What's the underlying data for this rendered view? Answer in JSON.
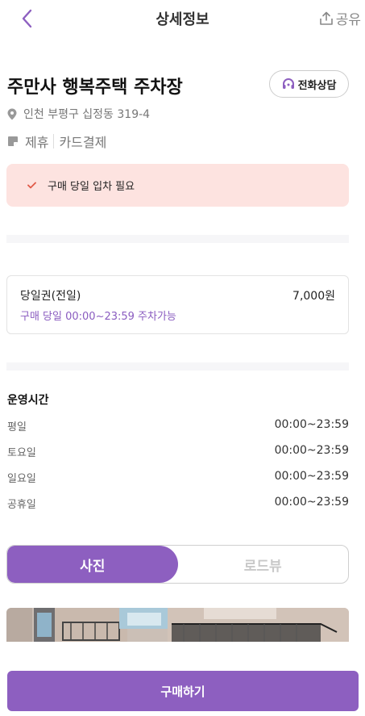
{
  "header": {
    "title": "상세정보",
    "share_label": "공유"
  },
  "lot": {
    "name": "주만사 행복주택 주차장",
    "call_label": "전화상담",
    "address": "인천 부평구 십정동 319-4",
    "tags": [
      "제휴",
      "카드결제"
    ]
  },
  "notice": {
    "text": "구매 당일 입차 필요"
  },
  "ticket": {
    "name": "당일권(전일)",
    "price": "7,000원",
    "time": "구매 당일 00:00~23:59 주차가능"
  },
  "hours": {
    "title": "운영시간",
    "rows": [
      {
        "day": "평일",
        "time": "00:00~23:59"
      },
      {
        "day": "토요일",
        "time": "00:00~23:59"
      },
      {
        "day": "일요일",
        "time": "00:00~23:59"
      },
      {
        "day": "공휴일",
        "time": "00:00~23:59"
      }
    ]
  },
  "media_tabs": {
    "photo_label": "사진",
    "roadview_label": "로드뷰"
  },
  "footer": {
    "buy_label": "구매하기"
  },
  "colors": {
    "accent": "#8d5fc0",
    "notice_bg": "#fde3e0",
    "check": "#e05a48"
  },
  "icons": {
    "back": "chevron-left-icon",
    "share": "share-icon",
    "call": "headset-icon",
    "location": "location-pin-icon",
    "tag": "tag-icon",
    "check": "check-icon"
  }
}
